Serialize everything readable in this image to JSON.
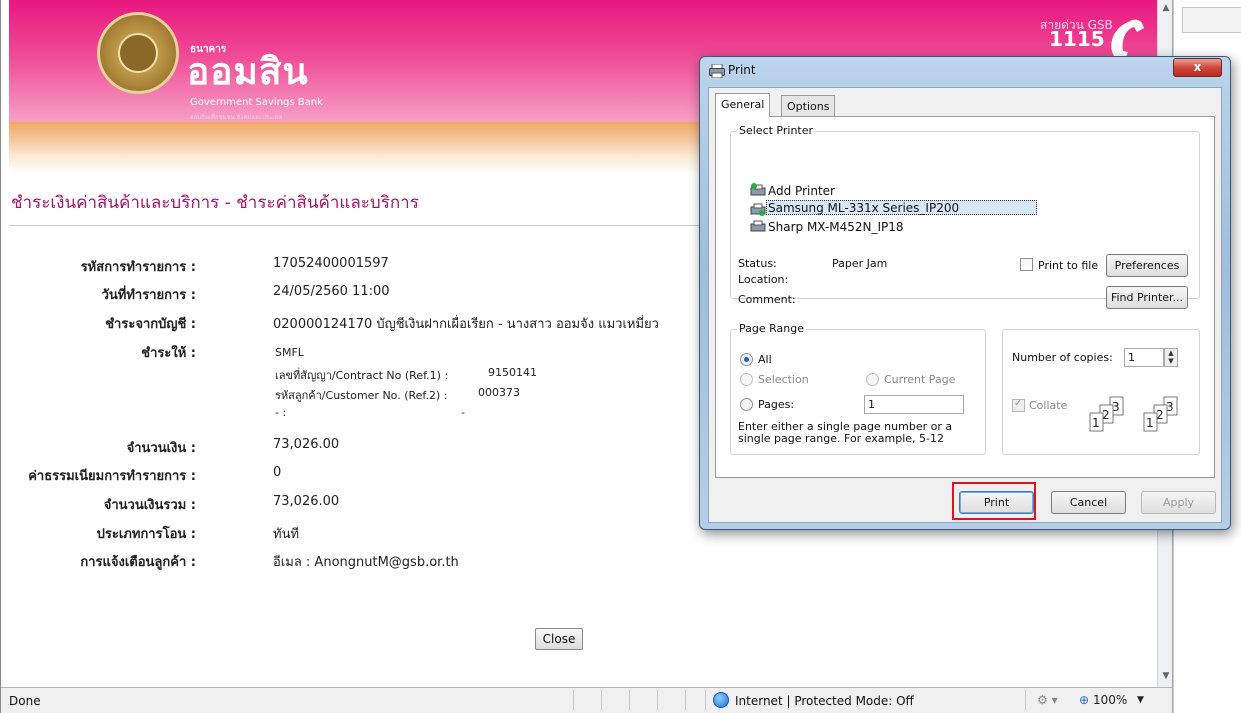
{
  "header": {
    "bank_small": "ธนาคาร",
    "bank_name": "ออมสิน",
    "bank_name_en": "Government Savings Bank",
    "tagline": "ออมสินเพื่อชุมชน สังคมและประเทศ",
    "hotline_label": "สายด่วน GSB",
    "hotline_number": "1115"
  },
  "page": {
    "title": "ชำระเงินค่าสินค้าและบริการ - ชำระค่าสินค้าและบริการ",
    "fields": {
      "ref_label": "รหัสการทำรายการ :",
      "ref_value": "17052400001597",
      "date_label": "วันที่ทำรายการ :",
      "date_value": "24/05/2560 11:00",
      "from_label": "ชำระจากบัญชี :",
      "from_value": "020000124170 บัญชีเงินฝากเผื่อเรียก - นางสาว ออมจัง แมวเหมี่ยว",
      "to_label": "ชำระให้ :",
      "to_value": "SMFL",
      "ref1_label": "เลขที่สัญญา/Contract No (Ref.1) :",
      "ref1_value": "9150141",
      "ref2_label": "รหัสลูกค้า/Customer No. (Ref.2) :",
      "ref2_value": "000373",
      "ref3_label": "- :",
      "ref3_value": "-",
      "amount_label": "จำนวนเงิน :",
      "amount_value": "73,026.00",
      "fee_label": "ค่าธรรมเนียมการทำรายการ :",
      "fee_value": "0",
      "total_label": "จำนวนเงินรวม :",
      "total_value": "73,026.00",
      "transfer_type_label": "ประเภทการโอน :",
      "transfer_type_value": "ทันที",
      "notify_label": "การแจ้งเตือนลูกค้า :",
      "notify_value": "อีเมล : AnongnutM@gsb.or.th"
    },
    "close_label": "Close"
  },
  "statusbar": {
    "status": "Done",
    "zone": "Internet | Protected Mode: Off",
    "zoom": "100%"
  },
  "dialog": {
    "title": "Print",
    "close_symbol": "x",
    "tabs": [
      "General",
      "Options"
    ],
    "select_printer_label": "Select Printer",
    "printers": [
      "Add Printer",
      "Samsung ML-331x Series_IP200",
      "Sharp MX-M452N_IP18"
    ],
    "status_label": "Status:",
    "status_value": "Paper Jam",
    "location_label": "Location:",
    "comment_label": "Comment:",
    "print_to_file_label": "Print to file",
    "preferences_label": "Preferences",
    "find_printer_label": "Find Printer...",
    "page_range_label": "Page Range",
    "all_label": "All",
    "selection_label": "Selection",
    "current_page_label": "Current Page",
    "pages_label": "Pages:",
    "pages_value": "1",
    "hint": "Enter either a single page number or a single page range.  For example, 5-12",
    "copies_label": "Number of copies:",
    "copies_value": "1",
    "collate_label": "Collate",
    "print_label": "Print",
    "cancel_label": "Cancel",
    "apply_label": "Apply"
  },
  "colors": {
    "brand": "#e8177e",
    "title_text": "#a0166a",
    "highlight": "#e0141e"
  }
}
